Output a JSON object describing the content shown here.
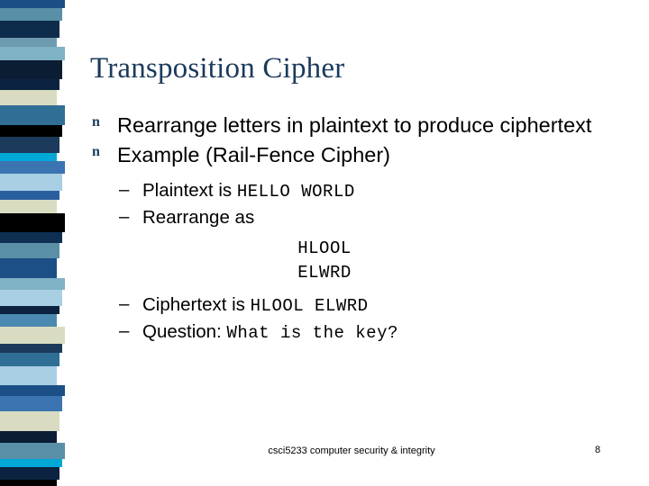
{
  "slide": {
    "title": "Transposition Cipher",
    "bullet_glyph": "n",
    "dash_glyph": "–",
    "bullets": [
      {
        "level": 1,
        "text": "Rearrange letters in plaintext to produce ciphertext"
      },
      {
        "level": 1,
        "text": "Example (Rail-Fence Cipher)"
      },
      {
        "level": 2,
        "label": "Plaintext is ",
        "mono": "HELLO WORLD"
      },
      {
        "level": 2,
        "label": "Rearrange as",
        "mono": ""
      },
      {
        "level": 2,
        "label": "Ciphertext is ",
        "mono": "HLOOL ELWRD"
      },
      {
        "level": 2,
        "label": "Question: ",
        "mono": "What is the key?"
      }
    ],
    "rail_lines": [
      "HLOOL",
      "ELWRD"
    ],
    "footer_text": "csci5233 computer security & integrity",
    "page_number": "8"
  },
  "decoration": {
    "stripe_colors": [
      "#1c4f86",
      "#5a8fa8",
      "#0d2b4a",
      "#6f9bb0",
      "#7fb2c4",
      "#0a1d33",
      "#0b2340",
      "#d9dcc0",
      "#2f6f95",
      "#000000",
      "#1b3a5c",
      "#00a8d6",
      "#3b74b0",
      "#a8cfe4",
      "#2a5f9e",
      "#d9dcc0",
      "#000000",
      "#0f2f52",
      "#5a8fa8",
      "#1c4f86",
      "#7fb2c4",
      "#a8cfe4",
      "#0b2340",
      "#4a8ab0",
      "#d9dcc0",
      "#1b3a5c",
      "#2f6f95",
      "#a8cfe4",
      "#1c4f86",
      "#3b74b0",
      "#d9dcc0",
      "#0a1d33",
      "#5a8fa8",
      "#00a8d6",
      "#0b2340",
      "#000000"
    ]
  }
}
